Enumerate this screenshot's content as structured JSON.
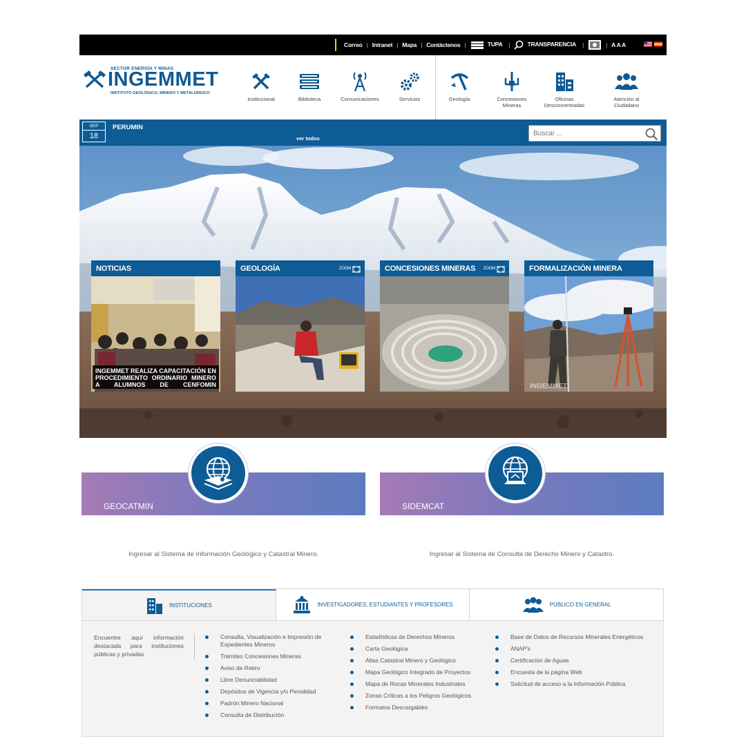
{
  "topbar": {
    "links": [
      "Correo",
      "Intranet",
      "Mapa",
      "Contáctenos"
    ],
    "tupa": "TUPA",
    "transparencia": "TRANSPARENCIA",
    "font_sizes": "A A A"
  },
  "header": {
    "logo": {
      "sector": "SECTOR ENERGÍA Y MINAS",
      "brand": "INGEMMET",
      "subtitle": "INSTITUTO GEOLÓGICO, MINERO Y METALÚRGICO"
    },
    "nav": [
      {
        "label": "Institucional",
        "icon": "tools-icon"
      },
      {
        "label": "Biblioteca",
        "icon": "books-icon"
      },
      {
        "label": "Comunicaciones",
        "icon": "antenna-icon"
      },
      {
        "label": "Servicios",
        "icon": "gears-icon"
      },
      {
        "label": "Geología",
        "icon": "pickaxe-icon"
      },
      {
        "label": "Concesiones Mineras",
        "icon": "claim-icon"
      },
      {
        "label": "Oficinas Desconcentradas",
        "icon": "building-icon"
      },
      {
        "label": "Atención al Ciudadano",
        "icon": "people-icon"
      }
    ]
  },
  "events": {
    "month": "SEP",
    "day": "18",
    "title": "PERUMIN",
    "see_all": "ver todos"
  },
  "search": {
    "placeholder": "Buscar ..."
  },
  "cards": [
    {
      "title": "NOTICIAS",
      "caption": "INGEMMET REALIZA CAPACITACIÓN EN PROCEDIMIENTO ORDINARIO MINERO A ALUMNOS DE CENFOMIN"
    },
    {
      "title": "GEOLOGÍA",
      "zoom": "ZOOM"
    },
    {
      "title": "CONCESIONES MINERAS",
      "zoom": "ZOOM"
    },
    {
      "title": "FORMALIZACIÓN MINERA",
      "watermark": "INGEMMET"
    }
  ],
  "systems": [
    {
      "name": "GEOCATMIN",
      "description": "Ingresar al Sistema de Información Geológico y Catastral Minero."
    },
    {
      "name": "SIDEMCAT",
      "description": "Ingresar al Sistema de Consulta de Derecho Minero y Catastro."
    }
  ],
  "tabs": [
    {
      "label": "INSTITUCIONES",
      "active": true
    },
    {
      "label": "INVESTIGADORES, ESTUDIANTES Y PROFESORES",
      "active": false
    },
    {
      "label": "PÚBLICO EN GENERAL",
      "active": false
    }
  ],
  "panel": {
    "intro": "Encuentre aquí información destacada para instituciones públicas y privadas",
    "columns": [
      [
        "Consulta, Visualización e Impresión de Expedientes Mineros",
        "Trámites Concesiones Mineras",
        "Aviso de Retiro",
        "Libre Denunciabilidad",
        "Depósitos de Vigencia y/o Penalidad",
        "Padrón Minero Nacional",
        "Consulta de Distribución"
      ],
      [
        "Estadísticas de Derechos Mineros",
        "Carta Geológica",
        "Atlas Catastral Minero y Geológico",
        "Mapa Geológico Integrado de Proyectos",
        "Mapa de Rocas Minerales Industriales",
        "Zonas Críticas a los Peligros Geológicos",
        "Formatos Descargables"
      ],
      [
        "Base de Datos de Recursos Minerales Energéticos",
        "ANAP's",
        "Certificación de Aguas",
        "Encuesta de la página Web",
        "Solicitud de acceso a la Información Pública"
      ]
    ]
  },
  "colors": {
    "brand_blue": "#0d5c95",
    "topbar_bg": "#000000",
    "panel_bg": "#f3f3f3"
  }
}
